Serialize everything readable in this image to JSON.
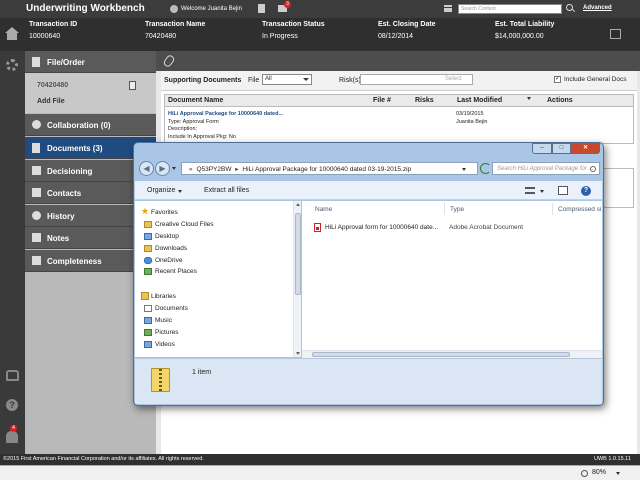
{
  "app": {
    "title": "Underwriting Workbench",
    "welcome": "Welcome Juanita Bejin",
    "mail_count": "3",
    "search_placeholder": "Search Content",
    "advanced_label": "Advanced"
  },
  "transaction": {
    "id_label": "Transaction ID",
    "id_value": "10000640",
    "name_label": "Transaction Name",
    "name_value": "70420480",
    "status_label": "Transaction Status",
    "status_value": "In Progress",
    "closing_label": "Est. Closing Date",
    "closing_value": "08/12/2014",
    "liability_label": "Est. Total Liability",
    "liability_value": "$14,000,000.00"
  },
  "nav": {
    "file_order": "File/Order",
    "file_id": "70420480",
    "add_file": "Add File",
    "collaboration": "Collaboration (0)",
    "documents": "Documents (3)",
    "decisioning": "Decisioning",
    "contacts": "Contacts",
    "history": "History",
    "notes": "Notes",
    "completeness": "Completeness"
  },
  "rail": {
    "notification_count": "4"
  },
  "documents": {
    "title": "Supporting Documents",
    "file_label": "File",
    "file_select": "All",
    "risk_label": "Risk(s)",
    "risk_placeholder": "Select",
    "include_general": "Include General Docs",
    "include_checked": "✓",
    "col_name": "Document Name",
    "col_file": "File #",
    "col_risks": "Risks",
    "col_modified": "Last Modified",
    "col_actions": "Actions",
    "row_title": "HiLi Approval Package for 10000640 dated...",
    "row_type": "Type: Approval Form",
    "row_desc": "Description:",
    "row_include": "Include In Approval Pkg: No",
    "row_date": "03/19/2015",
    "row_user": "Juanita Bejin"
  },
  "explorer": {
    "address_root": "Q53PY2BW",
    "address_path": "HiLi Approval Package for 10000640 dated 03-19-2015.zip",
    "search_placeholder": "Search HiLi Approval Package for ...",
    "organize": "Organize",
    "extract_all": "Extract all files",
    "favorites": "Favorites",
    "nav_items": [
      "Creative Cloud Files",
      "Desktop",
      "Downloads",
      "OneDrive",
      "Recent Places"
    ],
    "libraries": "Libraries",
    "lib_items": [
      "Documents",
      "Music",
      "Pictures",
      "Videos"
    ],
    "col_name": "Name",
    "col_type": "Type",
    "col_compressed": "Compressed si",
    "file_name": "HiLi Approval form for 10000640 date...",
    "file_type": "Adobe Acrobat Document",
    "items_count": "1 item"
  },
  "footer": {
    "copyright": "©2015 First American Financial Corporation and/or its affiliates. All rights reserved.",
    "version": "UWB 1.0.15.11"
  },
  "statusbar": {
    "zoom": "80%"
  }
}
